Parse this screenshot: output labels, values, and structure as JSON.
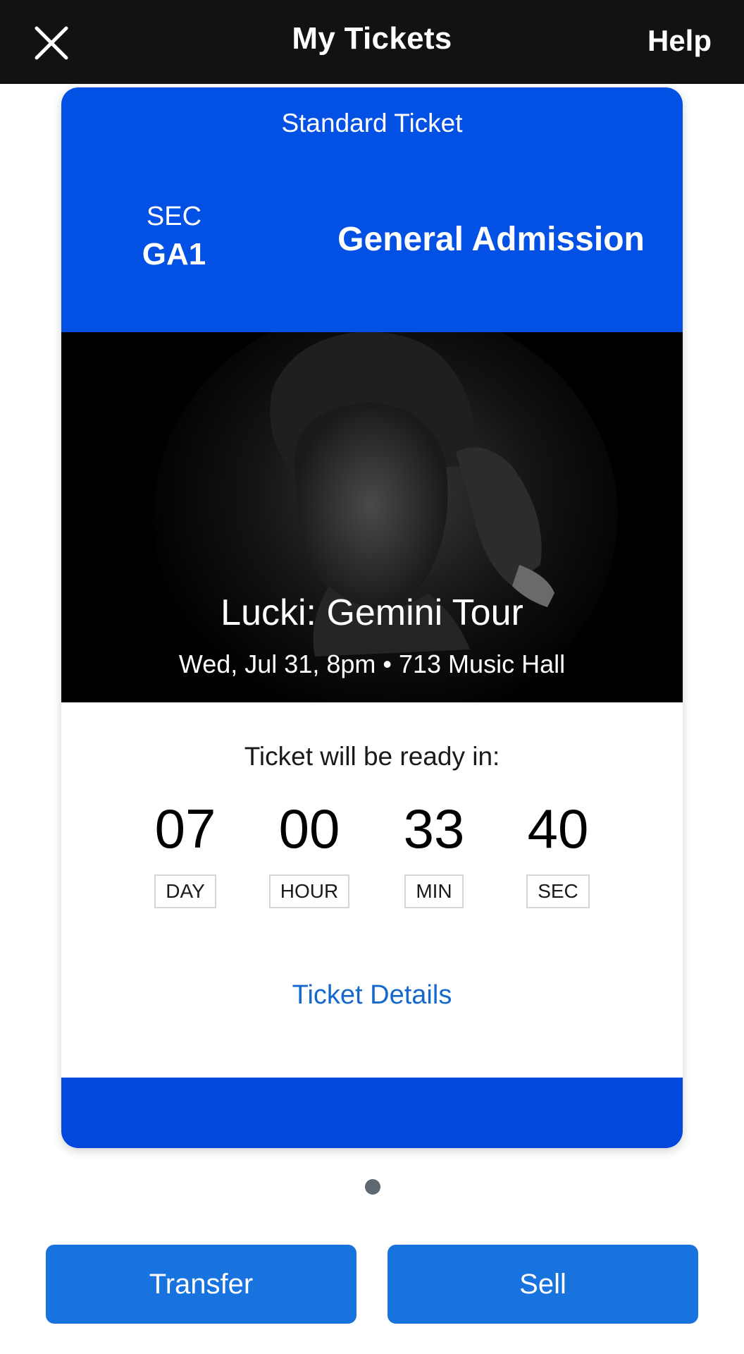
{
  "header": {
    "title": "My Tickets",
    "help_label": "Help",
    "close_icon": "close-icon"
  },
  "ticket": {
    "type": "Standard Ticket",
    "section_label": "SEC",
    "section_value": "GA1",
    "admission": "General Admission",
    "event_name": "Lucki: Gemini Tour",
    "event_meta": "Wed, Jul 31, 8pm • 713 Music Hall",
    "ready_text": "Ticket will be ready in:",
    "countdown": [
      {
        "value": "07",
        "label": "DAY"
      },
      {
        "value": "00",
        "label": "HOUR"
      },
      {
        "value": "33",
        "label": "MIN"
      },
      {
        "value": "40",
        "label": "SEC"
      }
    ],
    "details_link": "Ticket Details"
  },
  "pagination": {
    "current": 1,
    "total": 1
  },
  "actions": {
    "transfer_label": "Transfer",
    "sell_label": "Sell"
  },
  "colors": {
    "topbar": "#121212",
    "ticket_blue": "#0350e4",
    "button_blue": "#1873de",
    "link_blue": "#1669cc"
  }
}
